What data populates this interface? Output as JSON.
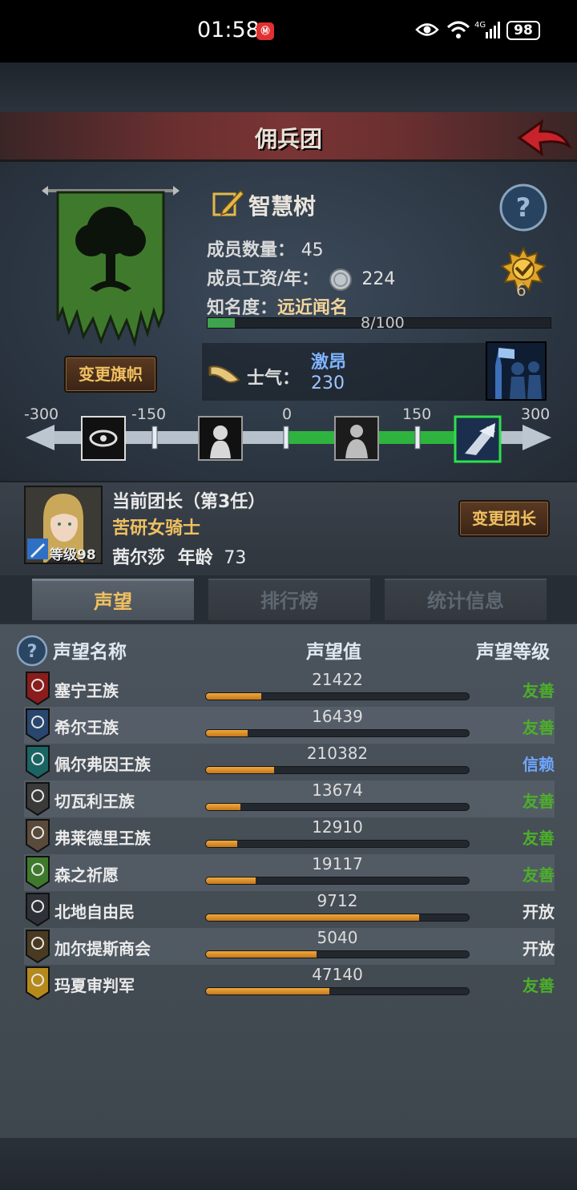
{
  "status_bar": {
    "time": "01:58",
    "app_badge": "Ⓜ",
    "net_label": "4G",
    "wifi_label": "6",
    "battery": "98"
  },
  "header": {
    "title": "佣兵团"
  },
  "guild": {
    "name": "智慧树",
    "members_label": "成员数量：",
    "members": "45",
    "salary_label": "成员工资/年：",
    "salary": "224",
    "fame_label": "知名度：",
    "fame_value": "远近闻名",
    "fame_progress_text": "8/100",
    "fame_progress": 0.08,
    "rank": "6",
    "change_banner_label": "变更旗帜",
    "banner_color": "#3f7a2c"
  },
  "morale": {
    "label": "士气：",
    "state": "激昂",
    "value": "230",
    "scale_ticks": [
      "-300",
      "-150",
      "0",
      "150",
      "300"
    ],
    "scale_min": -300,
    "scale_max": 300
  },
  "leader": {
    "title": "当前团长（第3任）",
    "class_name": "苦研女骑士",
    "name": "茜尔莎",
    "age_label": "年龄",
    "age": "73",
    "level_label": "等级98",
    "change_leader_label": "变更团长"
  },
  "tabs": [
    {
      "label": "声望",
      "active": true
    },
    {
      "label": "排行榜",
      "active": false
    },
    {
      "label": "统计信息",
      "active": false
    }
  ],
  "reputation": {
    "columns": [
      "声望名称",
      "声望值",
      "声望等级"
    ],
    "colors": {
      "friendly": "#4caf2a",
      "trust": "#6ea6ff",
      "open": "#e8e8e8"
    },
    "rows": [
      {
        "name": "塞宁王族",
        "value": "21422",
        "level": "友善",
        "level_type": "friendly",
        "progress": 0.21,
        "emblem_color": "#8a1c1c"
      },
      {
        "name": "希尔王族",
        "value": "16439",
        "level": "友善",
        "level_type": "friendly",
        "progress": 0.16,
        "emblem_color": "#28466e"
      },
      {
        "name": "佩尔弗因王族",
        "value": "210382",
        "level": "信赖",
        "level_type": "trust",
        "progress": 0.26,
        "emblem_color": "#1b6464"
      },
      {
        "name": "切瓦利王族",
        "value": "13674",
        "level": "友善",
        "level_type": "friendly",
        "progress": 0.13,
        "emblem_color": "#3a3a3a"
      },
      {
        "name": "弗莱德里王族",
        "value": "12910",
        "level": "友善",
        "level_type": "friendly",
        "progress": 0.12,
        "emblem_color": "#5a4a3a"
      },
      {
        "name": "森之祈愿",
        "value": "19117",
        "level": "友善",
        "level_type": "friendly",
        "progress": 0.19,
        "emblem_color": "#3f7a2c"
      },
      {
        "name": "北地自由民",
        "value": "9712",
        "level": "开放",
        "level_type": "open",
        "progress": 0.81,
        "emblem_color": "#2e3238"
      },
      {
        "name": "加尔提斯商会",
        "value": "5040",
        "level": "开放",
        "level_type": "open",
        "progress": 0.42,
        "emblem_color": "#4a3a22"
      },
      {
        "name": "玛夏审判军",
        "value": "47140",
        "level": "友善",
        "level_type": "friendly",
        "progress": 0.47,
        "emblem_color": "#b58a1a"
      }
    ]
  }
}
